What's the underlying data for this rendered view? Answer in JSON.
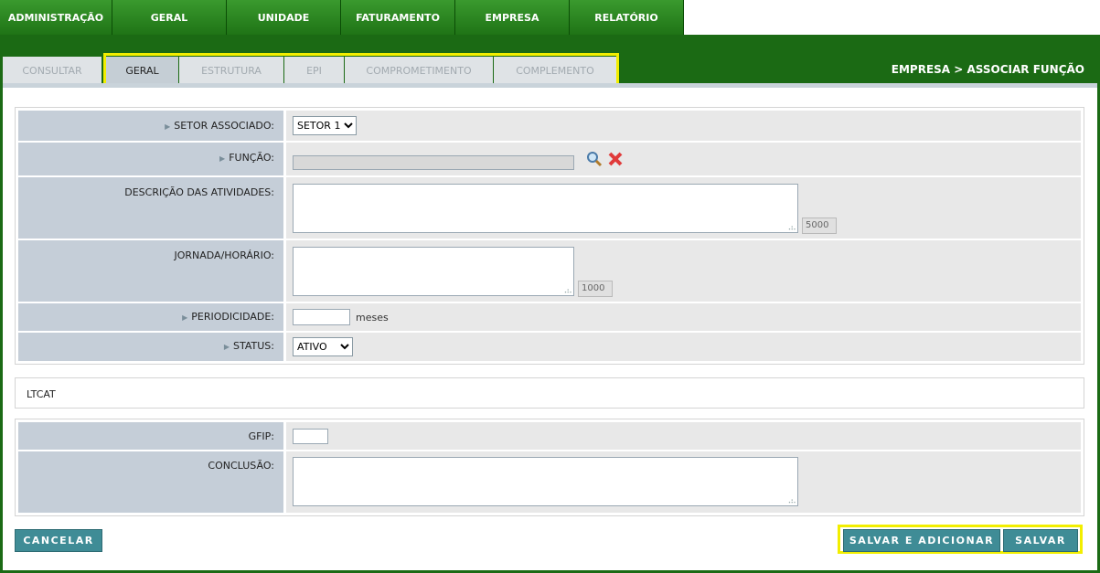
{
  "top_nav": [
    "ADMINISTRAÇÃO",
    "GERAL",
    "UNIDADE",
    "FATURAMENTO",
    "EMPRESA",
    "RELATÓRIO"
  ],
  "sub_tabs": [
    "CONSULTAR",
    "GERAL",
    "ESTRUTURA",
    "EPI",
    "COMPROMETIMENTO",
    "COMPLEMENTO"
  ],
  "active_sub_tab": "GERAL",
  "breadcrumb": "EMPRESA > ASSOCIAR FUNÇÃO",
  "form": {
    "setor_label": "SETOR ASSOCIADO:",
    "setor_value": "SETOR 1",
    "funcao_label": "FUNÇÃO:",
    "funcao_value": "",
    "descricao_label": "DESCRIÇÃO DAS ATIVIDADES:",
    "descricao_counter": "5000",
    "jornada_label": "JORNADA/HORÁRIO:",
    "jornada_counter": "1000",
    "periodicidade_label": "PERIODICIDADE:",
    "periodicidade_value": "",
    "periodicidade_unit": "meses",
    "status_label": "STATUS:",
    "status_value": "ATIVO"
  },
  "ltcat": {
    "title": "LTCAT",
    "gfip_label": "GFIP:",
    "gfip_value": "",
    "conclusao_label": "CONCLUSÃO:"
  },
  "buttons": {
    "cancel": "CANCELAR",
    "save_add": "SALVAR E ADICIONAR",
    "save": "SALVAR"
  },
  "icons": {
    "search": "search-icon",
    "clear": "close-icon"
  },
  "colors": {
    "nav_green": "#1f7416",
    "button_teal": "#3f8c96",
    "highlight_yellow": "#f2ee00"
  }
}
